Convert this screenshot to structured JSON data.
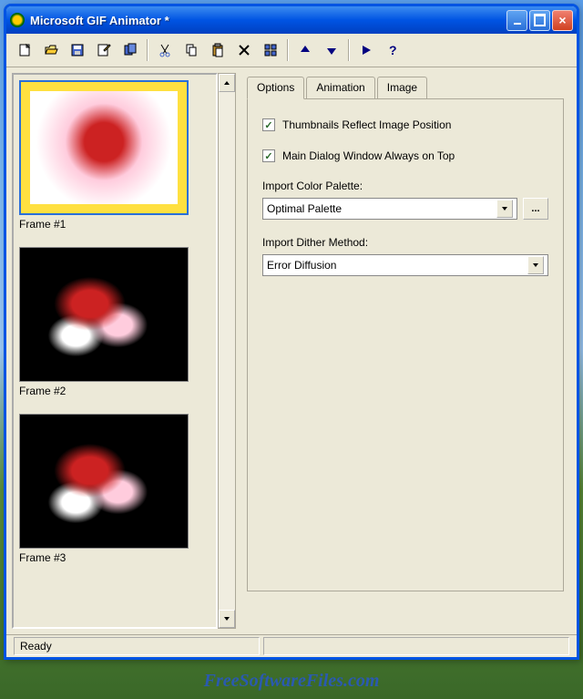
{
  "window": {
    "title": "Microsoft GIF Animator *"
  },
  "toolbar": {
    "new": "New",
    "open": "Open",
    "save": "Save",
    "save_as": "Save As",
    "insert": "Insert",
    "cut": "Cut",
    "copy": "Copy",
    "paste": "Paste",
    "delete": "Delete",
    "select_all": "Select All",
    "move_up": "Move Up",
    "move_down": "Move Down",
    "preview": "Preview",
    "help": "Help"
  },
  "frames": [
    {
      "label": "Frame #1"
    },
    {
      "label": "Frame #2"
    },
    {
      "label": "Frame #3"
    }
  ],
  "tabs": {
    "options": "Options",
    "animation": "Animation",
    "image": "Image"
  },
  "options": {
    "thumbnails_reflect": "Thumbnails Reflect Image Position",
    "always_on_top": "Main Dialog Window Always on Top",
    "import_palette_label": "Import Color Palette:",
    "import_palette_value": "Optimal Palette",
    "browse": "...",
    "import_dither_label": "Import Dither Method:",
    "import_dither_value": "Error Diffusion"
  },
  "status": {
    "ready": "Ready"
  },
  "watermark": "FreeSoftwareFiles.com"
}
